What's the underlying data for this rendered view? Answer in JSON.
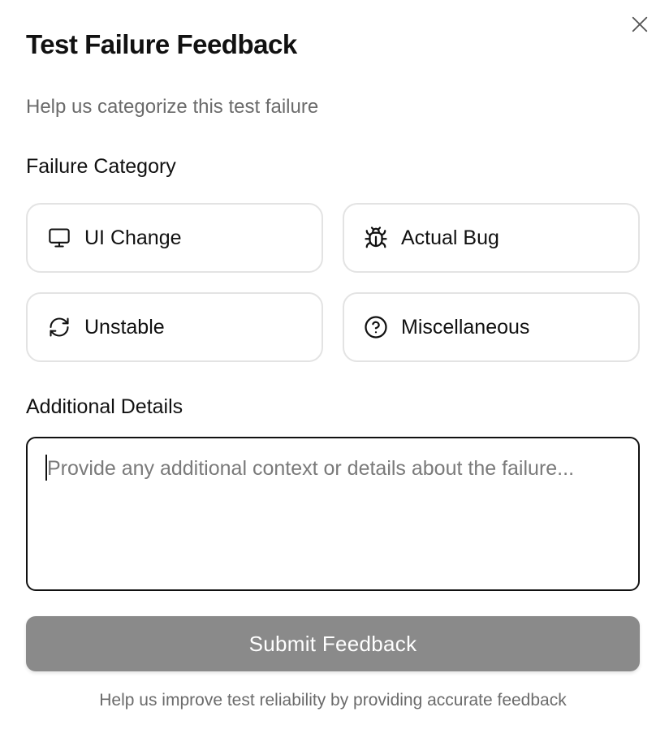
{
  "dialog": {
    "title": "Test Failure Feedback",
    "subtitle": "Help us categorize this test failure",
    "close_icon": "close-icon"
  },
  "category_section": {
    "label": "Failure Category",
    "options": [
      {
        "label": "UI Change",
        "icon": "monitor-icon"
      },
      {
        "label": "Actual Bug",
        "icon": "bug-icon"
      },
      {
        "label": "Unstable",
        "icon": "refresh-icon"
      },
      {
        "label": "Miscellaneous",
        "icon": "help-circle-icon"
      }
    ]
  },
  "details_section": {
    "label": "Additional Details",
    "value": "",
    "placeholder": "Provide any additional context or details about the failure..."
  },
  "submit": {
    "label": "Submit Feedback"
  },
  "footer": {
    "note": "Help us improve test reliability by providing accurate feedback"
  },
  "colors": {
    "submit_disabled_bg": "#8a8a8a",
    "option_border": "#e3e3e3",
    "muted_text": "#6b6b6b"
  }
}
